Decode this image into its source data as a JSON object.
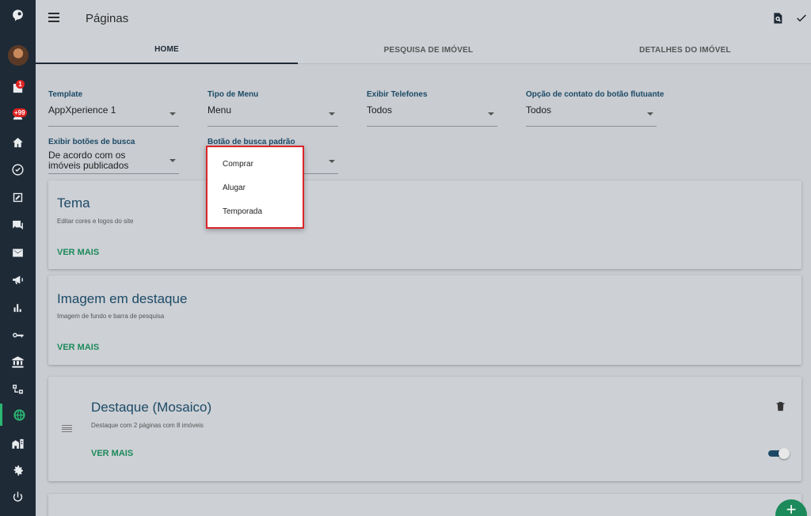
{
  "header": {
    "title": "Páginas"
  },
  "tabs": [
    {
      "label": "HOME"
    },
    {
      "label": "PESQUISA DE IMÓVEL"
    },
    {
      "label": "DETALHES DO IMÓVEL"
    }
  ],
  "sidebar": {
    "badges": {
      "notifications": "1",
      "leads": "+99"
    },
    "icons": [
      "logo-icon",
      "avatar",
      "notifications-icon",
      "leads-icon",
      "home-icon",
      "check-circle-icon",
      "edit-square-icon",
      "chat-icon",
      "mail-icon",
      "megaphone-icon",
      "bar-chart-icon",
      "key-icon",
      "bank-icon",
      "sitemap-icon",
      "globe-icon",
      "building-icon",
      "gear-icon",
      "power-icon"
    ],
    "accent": "#2bb673"
  },
  "form": {
    "template": {
      "label": "Template",
      "value": "AppXperience 1"
    },
    "menu_type": {
      "label": "Tipo de Menu",
      "value": "Menu"
    },
    "phones": {
      "label": "Exibir Telefones",
      "value": "Todos"
    },
    "float_contact": {
      "label": "Opção de contato do botão flutuante",
      "value": "Todos"
    },
    "search_buttons": {
      "label": "Exibir botões de busca",
      "value": "De acordo com os imóveis publicados"
    },
    "default_search": {
      "label": "Botão de busca padrão",
      "value": ""
    }
  },
  "dropdown": {
    "options": [
      "Comprar",
      "Alugar",
      "Temporada"
    ]
  },
  "cards": {
    "tema": {
      "title": "Tema",
      "subtitle": "Editar cores e logos do site",
      "link": "VER MAIS"
    },
    "imagem": {
      "title": "Imagem em destaque",
      "subtitle": "Imagem de fundo e barra de pesquisa",
      "link": "VER MAIS"
    },
    "destaque": {
      "title": "Destaque (Mosaico)",
      "subtitle": "Destaque com 2 páginas com 8 imóveis",
      "link": "VER MAIS",
      "enabled": true
    }
  },
  "fab": {
    "label": "+"
  },
  "colors": {
    "primary": "#1c4a66",
    "link": "#1c8a5a",
    "sidebar": "#1e2a36",
    "highlight": "#d9262b"
  }
}
